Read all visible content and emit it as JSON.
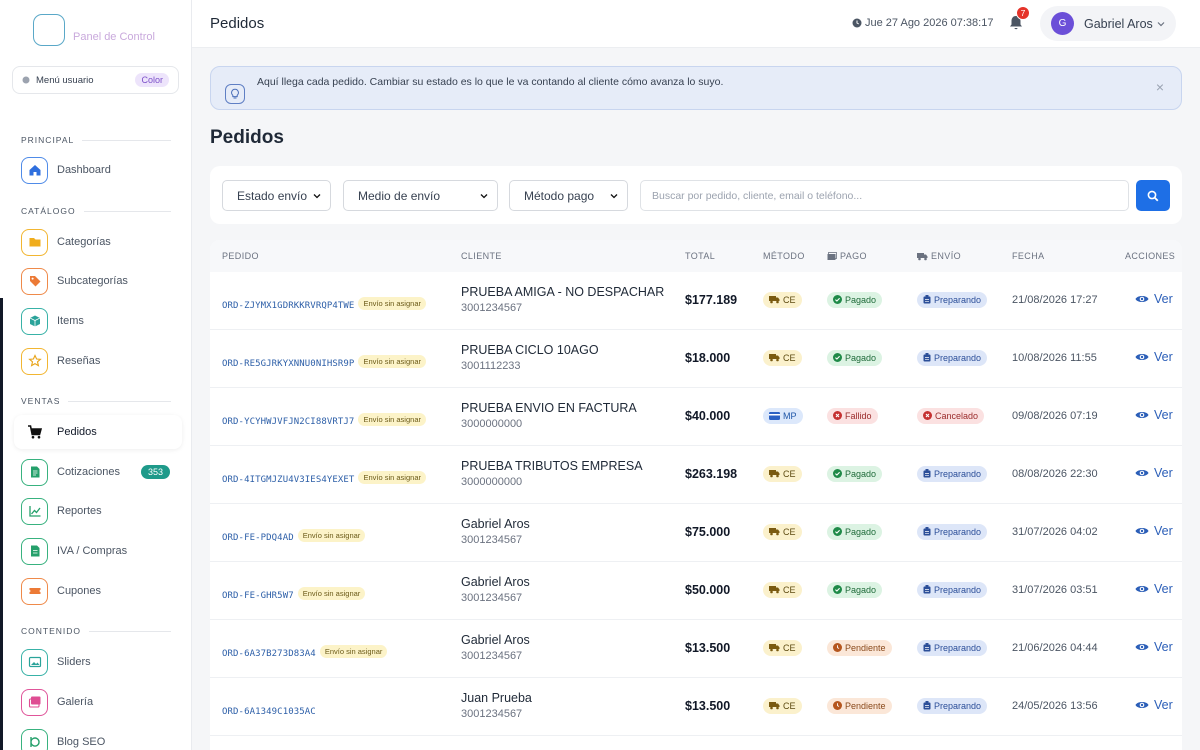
{
  "brand": {
    "logo_text": "Panel de Control"
  },
  "menu_user": {
    "label": "Menú usuario",
    "badge": "Color"
  },
  "sidebar": {
    "sections": [
      {
        "title": "PRINCIPAL"
      },
      {
        "title": "CATÁLOGO"
      },
      {
        "title": "VENTAS"
      },
      {
        "title": "CONTENIDO"
      }
    ],
    "items": [
      {
        "label": "Dashboard",
        "icon": "home-icon"
      },
      {
        "label": "Categorías",
        "icon": "folder-icon"
      },
      {
        "label": "Subcategorías",
        "icon": "tag-icon"
      },
      {
        "label": "Items",
        "icon": "cube-icon"
      },
      {
        "label": "Reseñas",
        "icon": "star-icon"
      },
      {
        "label": "Pedidos",
        "icon": "cart-icon"
      },
      {
        "label": "Cotizaciones",
        "icon": "document-icon",
        "count": "353"
      },
      {
        "label": "Reportes",
        "icon": "chart-line-icon"
      },
      {
        "label": "IVA / Compras",
        "icon": "receipt-icon"
      },
      {
        "label": "Cupones",
        "icon": "coupon-icon"
      },
      {
        "label": "Sliders",
        "icon": "image-icon"
      },
      {
        "label": "Galería",
        "icon": "gallery-icon"
      },
      {
        "label": "Blog SEO",
        "icon": "blog-icon"
      }
    ]
  },
  "topbar": {
    "title": "Pedidos",
    "datetime": "Jue 27 Ago 2026 07:38:17",
    "notifications": "7",
    "user_name": "Gabriel Aros",
    "user_initial": "G"
  },
  "alert": {
    "text": "Aquí llega cada pedido. Cambiar su estado es lo que le va contando al cliente cómo avanza lo suyo.",
    "close": "×"
  },
  "page": {
    "title": "Pedidos"
  },
  "filters": {
    "estado_envio": "Estado envío",
    "medio_envio": "Medio de envío",
    "metodo_pago": "Método pago",
    "search_placeholder": "Buscar por pedido, cliente, email o teléfono..."
  },
  "table": {
    "headers": {
      "pedido": "PEDIDO",
      "cliente": "CLIENTE",
      "total": "TOTAL",
      "metodo": "MÉTODO",
      "pago": "PAGO",
      "envio": "ENVÍO",
      "fecha": "FECHA",
      "acciones": "ACCIONES"
    },
    "rows": [
      {
        "id": "ORD-ZJYMX1GDRKKRVRQP4TWE",
        "tag": "Envío sin asignar",
        "name": "PRUEBA AMIGA - NO DESPACHAR",
        "phone": "3001234567",
        "total": "$177.189",
        "method": "CE",
        "payment": "Pagado",
        "shipping": "Preparando",
        "date": "21/08/2026 17:27",
        "action": "Ver"
      },
      {
        "id": "ORD-RE5GJRKYXNNU0NIHSR9P",
        "tag": "Envío sin asignar",
        "name": "PRUEBA CICLO 10AGO",
        "phone": "3001112233",
        "total": "$18.000",
        "method": "CE",
        "payment": "Pagado",
        "shipping": "Preparando",
        "date": "10/08/2026 11:55",
        "action": "Ver"
      },
      {
        "id": "ORD-YCYHWJVFJN2CI88VRTJ7",
        "tag": "Envío sin asignar",
        "name": "PRUEBA ENVIO EN FACTURA",
        "phone": "3000000000",
        "total": "$40.000",
        "method": "MP",
        "payment": "Fallido",
        "shipping": "Cancelado",
        "date": "09/08/2026 07:19",
        "action": "Ver"
      },
      {
        "id": "ORD-4ITGMJZU4V3IES4YEXET",
        "tag": "Envío sin asignar",
        "name": "PRUEBA TRIBUTOS EMPRESA",
        "phone": "3000000000",
        "total": "$263.198",
        "method": "CE",
        "payment": "Pagado",
        "shipping": "Preparando",
        "date": "08/08/2026 22:30",
        "action": "Ver"
      },
      {
        "id": "ORD-FE-PDQ4AD",
        "tag": "Envío sin asignar",
        "name": "Gabriel Aros",
        "phone": "3001234567",
        "total": "$75.000",
        "method": "CE",
        "payment": "Pagado",
        "shipping": "Preparando",
        "date": "31/07/2026 04:02",
        "action": "Ver"
      },
      {
        "id": "ORD-FE-GHR5W7",
        "tag": "Envío sin asignar",
        "name": "Gabriel Aros",
        "phone": "3001234567",
        "total": "$50.000",
        "method": "CE",
        "payment": "Pagado",
        "shipping": "Preparando",
        "date": "31/07/2026 03:51",
        "action": "Ver"
      },
      {
        "id": "ORD-6A37B273D83A4",
        "tag": "Envío sin asignar",
        "name": "Gabriel Aros",
        "phone": "3001234567",
        "total": "$13.500",
        "method": "CE",
        "payment": "Pendiente",
        "shipping": "Preparando",
        "date": "21/06/2026 04:44",
        "action": "Ver"
      },
      {
        "id": "ORD-6A1349C1035AC",
        "tag": "",
        "name": "Juan Prueba",
        "phone": "3001234567",
        "total": "$13.500",
        "method": "CE",
        "payment": "Pendiente",
        "shipping": "Preparando",
        "date": "24/05/2026 13:56",
        "action": "Ver"
      }
    ]
  },
  "colors": {
    "accent": "#1e6fe6",
    "link": "#2c5fb8",
    "avatar": "#6b4fd8",
    "notification": "#e5332a",
    "quote_badge": "#1f9a8a"
  }
}
